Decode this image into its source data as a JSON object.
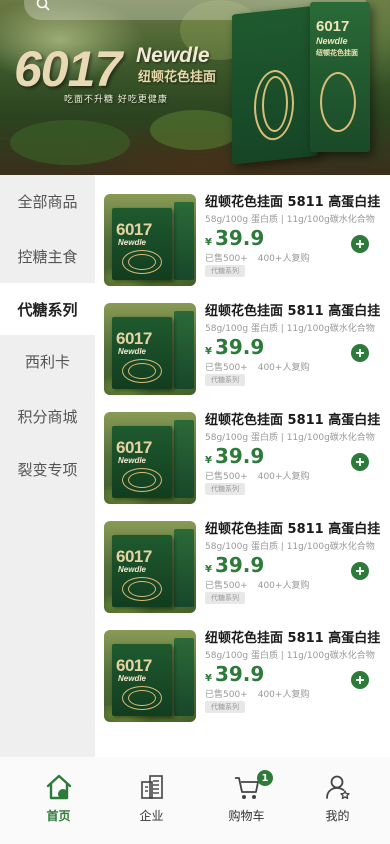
{
  "banner": {
    "brand_number": "6017",
    "brand_word": "Newdle",
    "brand_cn": "纽顿花色挂面",
    "slogan": "吃面不升糖 好吃更健康",
    "box_number": "6017",
    "box_brand": "Newdle",
    "box_cn": "纽顿花色挂面"
  },
  "sidebar": {
    "items": [
      {
        "label": "全部商品",
        "active": false
      },
      {
        "label": "控糖主食",
        "active": false
      },
      {
        "label": "代糖系列",
        "active": true
      },
      {
        "label": "西利卡",
        "active": false
      },
      {
        "label": "积分商城",
        "active": false
      },
      {
        "label": "裂变专项",
        "active": false
      }
    ]
  },
  "products": [
    {
      "name": "纽顿花色挂面 5811 高蛋白挂",
      "spec": "58g/100g 蛋白质 | 11g/100g碳水化合物",
      "currency": "¥",
      "price": "39.9",
      "sold": "已售500+",
      "buyers": "400+人复购",
      "tag": "代糖系列",
      "img_number": "6017",
      "img_brand": "Newdle"
    },
    {
      "name": "纽顿花色挂面 5811 高蛋白挂",
      "spec": "58g/100g 蛋白质 | 11g/100g碳水化合物",
      "currency": "¥",
      "price": "39.9",
      "sold": "已售500+",
      "buyers": "400+人复购",
      "tag": "代糖系列",
      "img_number": "6017",
      "img_brand": "Newdle"
    },
    {
      "name": "纽顿花色挂面 5811 高蛋白挂",
      "spec": "58g/100g 蛋白质 | 11g/100g碳水化合物",
      "currency": "¥",
      "price": "39.9",
      "sold": "已售500+",
      "buyers": "400+人复购",
      "tag": "代糖系列",
      "img_number": "6017",
      "img_brand": "Newdle"
    },
    {
      "name": "纽顿花色挂面 5811 高蛋白挂",
      "spec": "58g/100g 蛋白质 | 11g/100g碳水化合物",
      "currency": "¥",
      "price": "39.9",
      "sold": "已售500+",
      "buyers": "400+人复购",
      "tag": "代糖系列",
      "img_number": "6017",
      "img_brand": "Newdle"
    },
    {
      "name": "纽顿花色挂面 5811 高蛋白挂",
      "spec": "58g/100g 蛋白质 | 11g/100g碳水化合物",
      "currency": "¥",
      "price": "39.9",
      "sold": "已售500+",
      "buyers": "400+人复购",
      "tag": "代糖系列",
      "img_number": "6017",
      "img_brand": "Newdle"
    }
  ],
  "tabbar": {
    "tabs": [
      {
        "label": "首页",
        "icon": "home-icon",
        "active": true
      },
      {
        "label": "企业",
        "icon": "building-icon",
        "active": false
      },
      {
        "label": "购物车",
        "icon": "cart-icon",
        "active": false
      },
      {
        "label": "我的",
        "icon": "user-icon",
        "active": false
      }
    ],
    "cart_badge": "1"
  },
  "colors": {
    "accent": "#2d7a3a",
    "sidebar_bg": "#efefef",
    "text_muted": "#999999"
  }
}
